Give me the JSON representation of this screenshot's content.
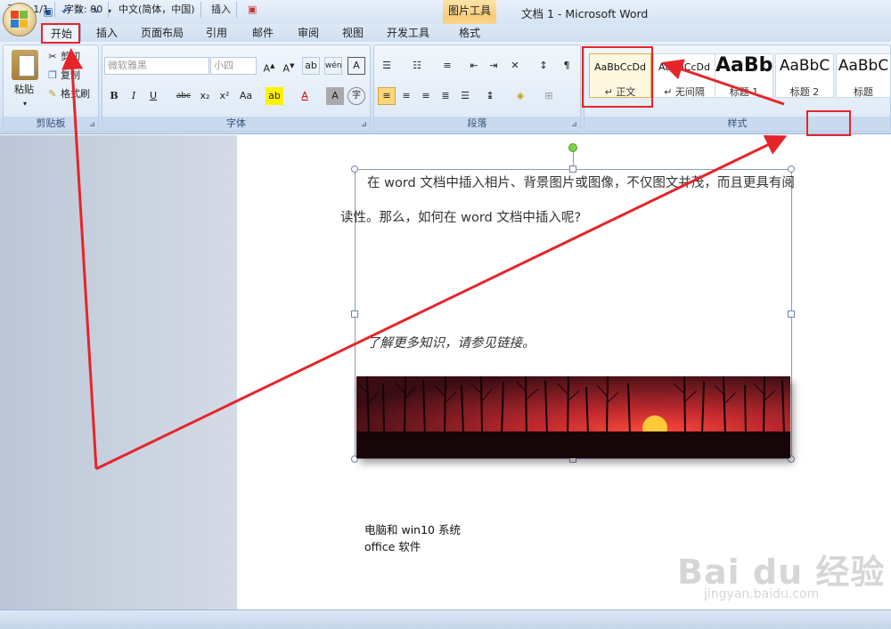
{
  "window": {
    "title": "文档 1 - Microsoft Word",
    "context_tab_group": "图片工具"
  },
  "tabs": [
    "开始",
    "插入",
    "页面布局",
    "引用",
    "邮件",
    "审阅",
    "视图",
    "开发工具",
    "格式"
  ],
  "ribbon": {
    "clipboard": {
      "label": "剪贴板",
      "paste": "粘贴",
      "cut": "剪切",
      "copy": "复制",
      "format_painter": "格式刷"
    },
    "font": {
      "label": "字体",
      "font_name": "微软雅黑",
      "font_size": "小四"
    },
    "paragraph": {
      "label": "段落"
    },
    "styles": {
      "label": "样式",
      "items": [
        {
          "preview": "AaBbCcDd",
          "name": "↵ 正文"
        },
        {
          "preview": "AaBbCcDd",
          "name": "↵ 无间隔"
        },
        {
          "preview": "AaBb",
          "name": "标题 1"
        },
        {
          "preview": "AaBbC",
          "name": "标题 2"
        },
        {
          "preview": "AaBbC",
          "name": "标题"
        }
      ]
    }
  },
  "document": {
    "line1": "在 word 文档中插入相片、背景图片或图像，不仅图文并茂，而且更具有阅",
    "line2": "读性。那么，如何在 word 文档中插入呢?",
    "line3": "了解更多知识，请参见链接。",
    "line4": "电脑和 win10 系统",
    "line5": "office 软件"
  },
  "status": {
    "page": "页面: 1/1",
    "words": "字数: 90",
    "language": "中文(简体，中国)",
    "mode": "插入"
  },
  "watermark": {
    "logo": "Bai du 经验",
    "url": "jingyan.baidu.com"
  },
  "colors": {
    "annotation": "#e5252a",
    "ribbon_accent": "#35507a"
  }
}
